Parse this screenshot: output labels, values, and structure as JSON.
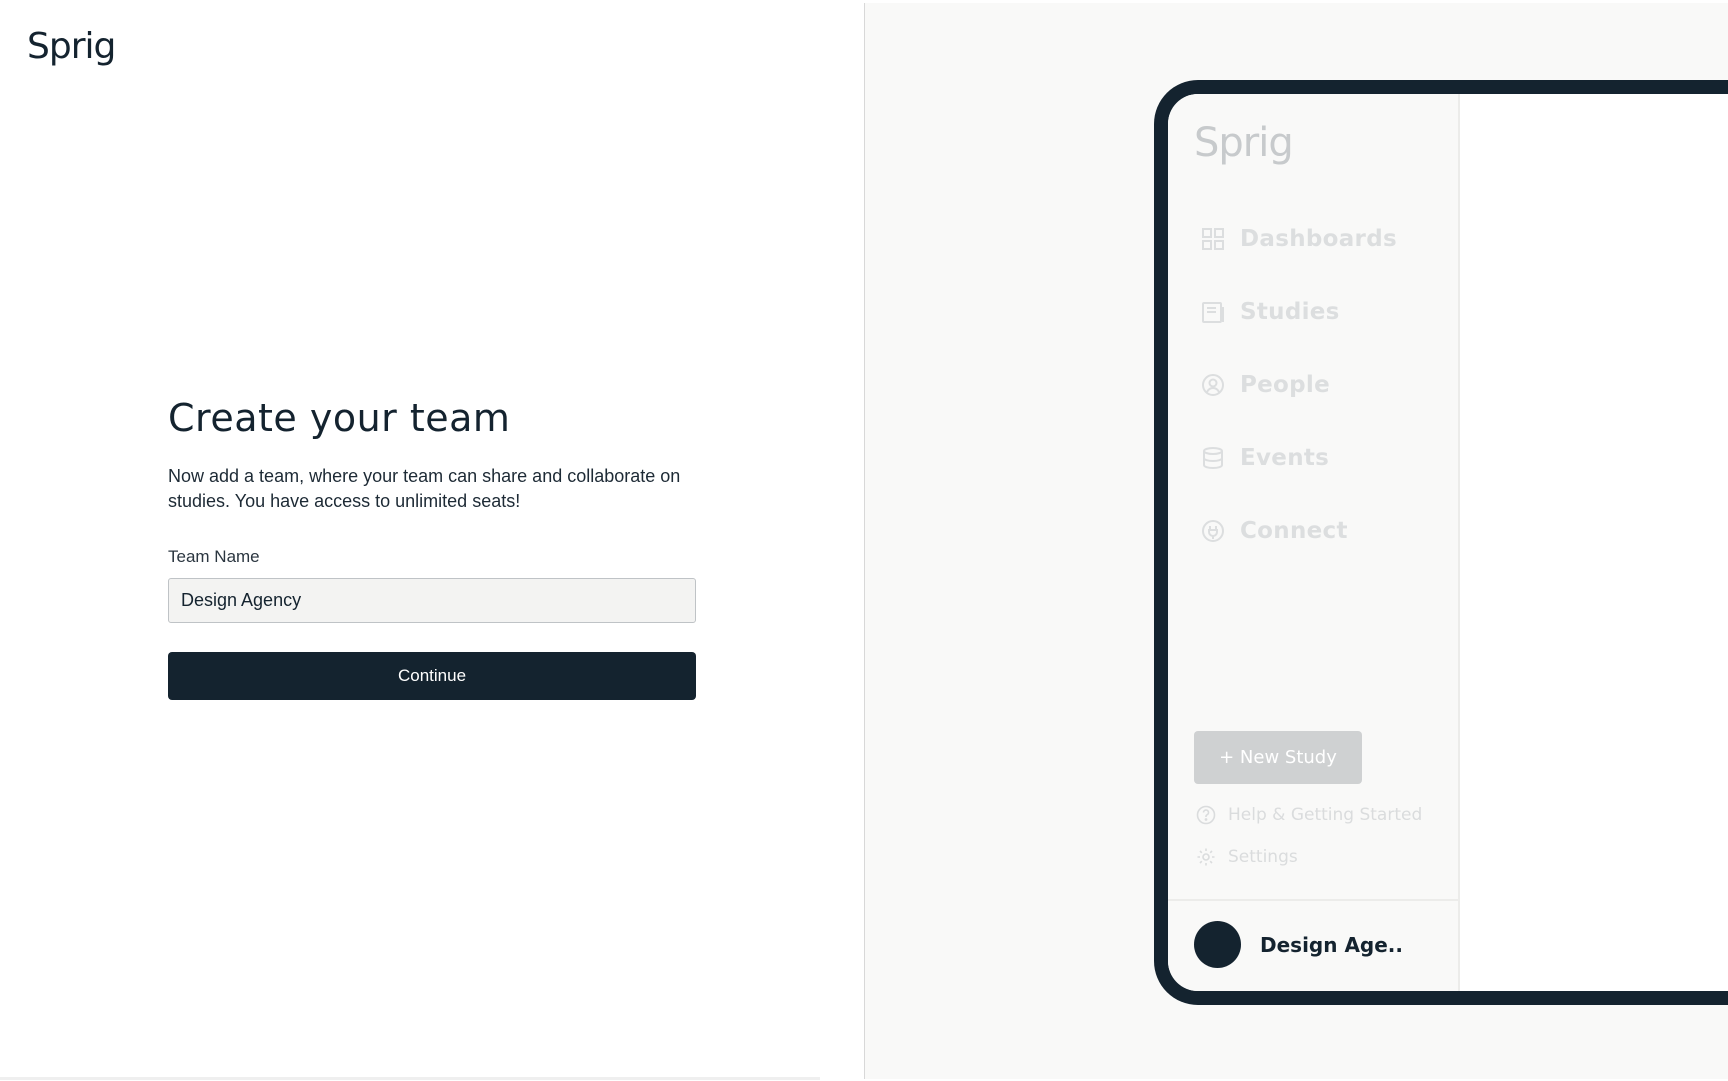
{
  "brand": {
    "logo_text": "Sprig"
  },
  "form": {
    "title": "Create your team",
    "subtitle": "Now add a team, where your team can share and collaborate on studies. You have access to unlimited seats!",
    "team_name_label": "Team Name",
    "team_name_value": "Design Agency",
    "continue_label": "Continue"
  },
  "preview": {
    "logo_text": "Sprig",
    "nav": [
      {
        "label": "Dashboards",
        "icon": "grid-icon"
      },
      {
        "label": "Studies",
        "icon": "document-icon"
      },
      {
        "label": "People",
        "icon": "person-circle-icon"
      },
      {
        "label": "Events",
        "icon": "database-icon"
      },
      {
        "label": "Connect",
        "icon": "plug-icon"
      }
    ],
    "new_study_label": "+ New Study",
    "help_label": "Help & Getting Started",
    "settings_label": "Settings",
    "account_name": "Design Age.."
  },
  "colors": {
    "primary": "#14232f",
    "input_bg": "#f3f3f2",
    "preview_bg": "#f9f9f8",
    "muted_text": "#dcdedf"
  }
}
